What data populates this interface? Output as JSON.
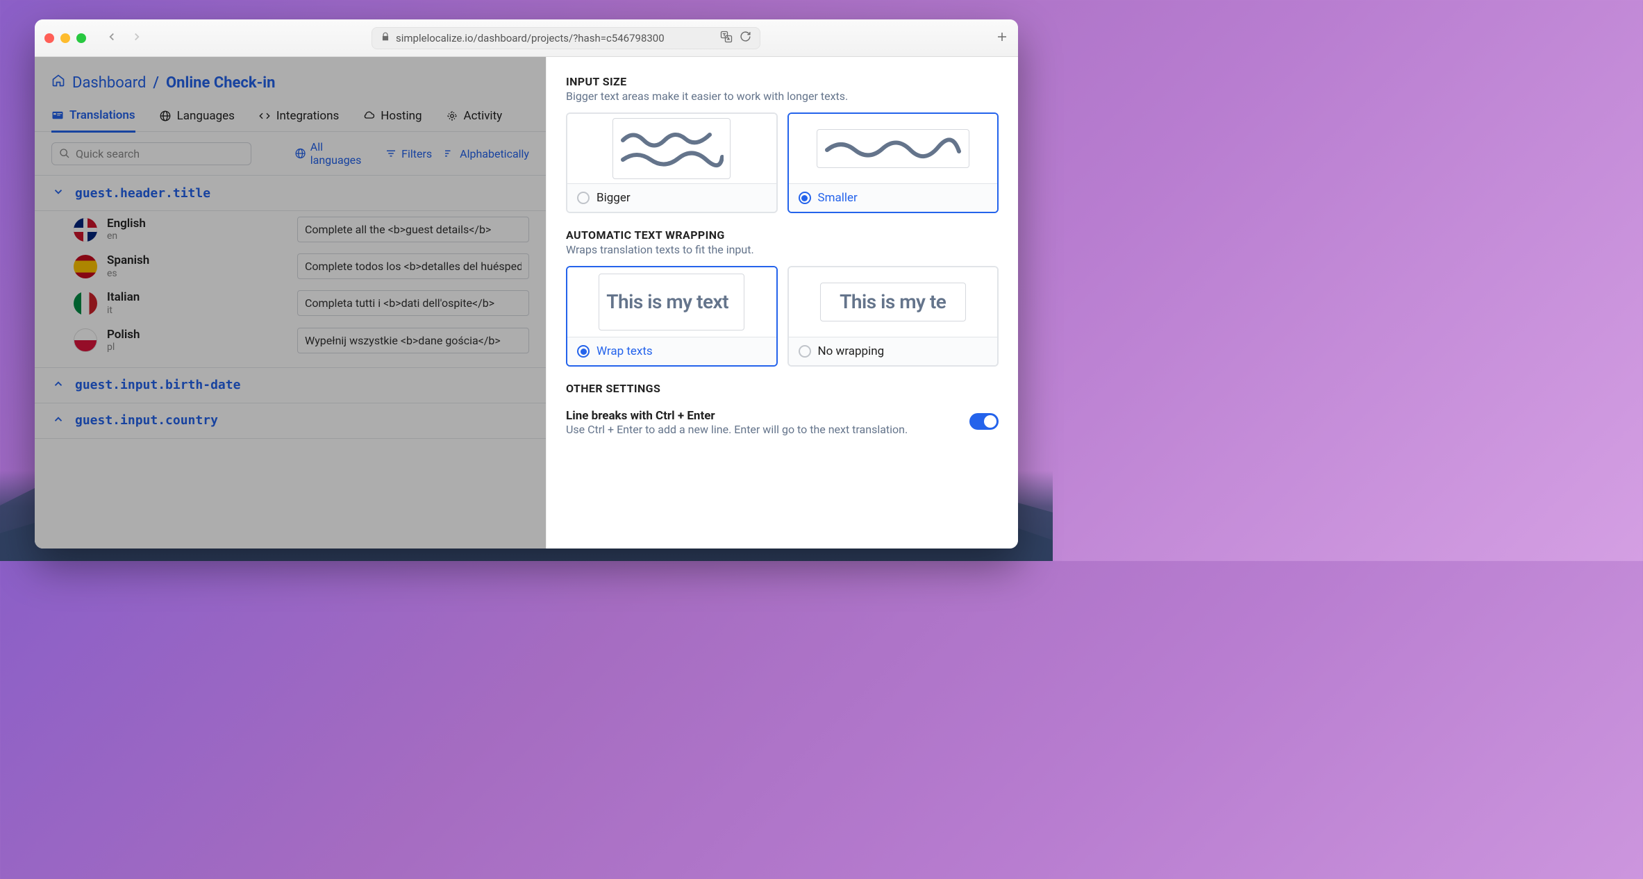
{
  "browser": {
    "url_display": "simplelocalize.io/dashboard/projects/?hash=c546798300"
  },
  "breadcrumb": {
    "dashboard_label": "Dashboard",
    "separator": "/",
    "current": "Online Check-in"
  },
  "tabs": [
    {
      "label": "Translations",
      "icon": "translations-icon",
      "active": true
    },
    {
      "label": "Languages",
      "icon": "globe-icon",
      "active": false
    },
    {
      "label": "Integrations",
      "icon": "code-icon",
      "active": false
    },
    {
      "label": "Hosting",
      "icon": "cloud-icon",
      "active": false
    },
    {
      "label": "Activity",
      "icon": "activity-icon",
      "active": false
    }
  ],
  "toolbar": {
    "search_placeholder": "Quick search",
    "all_languages": "All languages",
    "filters": "Filters",
    "sort": "Alphabetically"
  },
  "keys": [
    {
      "name": "guest.header.title",
      "expanded": true,
      "translations": [
        {
          "lang_name": "English",
          "lang_code": "en",
          "flag": "gb",
          "value": "Complete all the <b>guest details</b>"
        },
        {
          "lang_name": "Spanish",
          "lang_code": "es",
          "flag": "es",
          "value": "Complete todos los <b>detalles del huésped</b>"
        },
        {
          "lang_name": "Italian",
          "lang_code": "it",
          "flag": "it",
          "value": "Completa tutti i <b>dati dell'ospite</b>"
        },
        {
          "lang_name": "Polish",
          "lang_code": "pl",
          "flag": "pl",
          "value": "Wypełnij wszystkie <b>dane gościa</b>"
        }
      ]
    },
    {
      "name": "guest.input.birth-date",
      "expanded": false,
      "translations": []
    },
    {
      "name": "guest.input.country",
      "expanded": false,
      "translations": []
    }
  ],
  "panel": {
    "input_size": {
      "title": "INPUT SIZE",
      "desc": "Bigger text areas make it easier to work with longer texts.",
      "options": {
        "bigger": "Bigger",
        "smaller": "Smaller"
      },
      "selected": "smaller"
    },
    "wrapping": {
      "title": "AUTOMATIC TEXT WRAPPING",
      "desc": "Wraps translation texts to fit the input.",
      "options": {
        "wrap": "Wrap texts",
        "nowrap": "No wrapping"
      },
      "preview_text": "This is my text",
      "preview_text_nowrap": "This is my te",
      "selected": "wrap"
    },
    "other": {
      "title": "OTHER SETTINGS",
      "line_breaks": {
        "title": "Line breaks with Ctrl + Enter",
        "desc": "Use Ctrl + Enter to add a new line. Enter will go to the next translation.",
        "enabled": true
      }
    }
  }
}
